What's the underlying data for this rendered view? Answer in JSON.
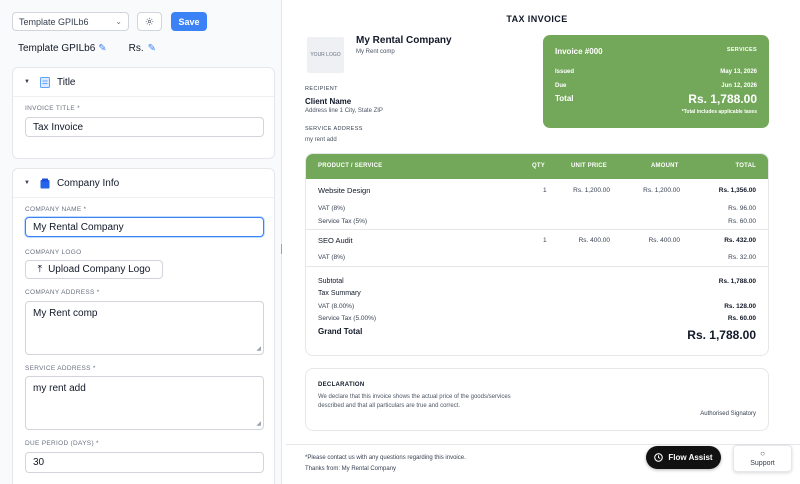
{
  "toolbar": {
    "template_select": "Template GPILb6",
    "save_label": "Save"
  },
  "template_row": {
    "name": "Template GPILb6",
    "currency": "Rs."
  },
  "title_section": {
    "heading": "Title",
    "invoice_title_label": "INVOICE TITLE *",
    "invoice_title_value": "Tax Invoice"
  },
  "company_section": {
    "heading": "Company Info",
    "company_name_label": "COMPANY NAME *",
    "company_name_value": "My Rental Company",
    "company_logo_label": "COMPANY LOGO",
    "upload_label": "Upload Company Logo",
    "company_address_label": "COMPANY ADDRESS *",
    "company_address_value": "My Rent comp",
    "service_address_label": "SERVICE ADDRESS *",
    "service_address_value": "my rent add",
    "due_period_label": "DUE PERIOD (DAYS) *",
    "due_period_value": "30"
  },
  "invoice": {
    "title": "TAX INVOICE",
    "logo_placeholder": "YOUR LOGO",
    "company_name": "My Rental Company",
    "company_sub": "My Rent comp",
    "recipient_label": "RECIPIENT",
    "client_name": "Client Name",
    "client_address": "Address line 1 City, State ZIP",
    "service_address_label": "SERVICE ADDRESS",
    "service_address": "my rent add",
    "summary_card": {
      "invoice_no": "Invoice #000",
      "type": "SERVICES",
      "issued_label": "Issued",
      "issued_value": "May 13, 2026",
      "due_label": "Due",
      "due_value": "Jun 12, 2026",
      "total_label": "Total",
      "total_value": "Rs. 1,788.00",
      "note": "*Total includes applicable taxes"
    },
    "table": {
      "headers": [
        "PRODUCT / SERVICE",
        "QTY",
        "UNIT PRICE",
        "AMOUNT",
        "TOTAL"
      ],
      "items": [
        {
          "name": "Website Design",
          "qty": "1",
          "unit_price": "Rs. 1,200.00",
          "amount": "Rs. 1,200.00",
          "total": "Rs. 1,356.00",
          "taxes": [
            {
              "label": "VAT (8%)",
              "value": "Rs. 96.00"
            },
            {
              "label": "Service Tax (5%)",
              "value": "Rs. 60.00"
            }
          ]
        },
        {
          "name": "SEO Audit",
          "qty": "1",
          "unit_price": "Rs. 400.00",
          "amount": "Rs. 400.00",
          "total": "Rs. 432.00",
          "taxes": [
            {
              "label": "VAT (8%)",
              "value": "Rs. 32.00"
            }
          ]
        }
      ],
      "subtotal_label": "Subtotal",
      "subtotal_value": "Rs. 1,788.00",
      "tax_summary_label": "Tax Summary",
      "tax_summary": [
        {
          "label": "VAT (8.00%)",
          "value": "Rs. 128.00"
        },
        {
          "label": "Service Tax (5.00%)",
          "value": "Rs. 60.00"
        }
      ],
      "grand_total_label": "Grand Total",
      "grand_total_value": "Rs. 1,788.00"
    },
    "declaration": {
      "title": "DECLARATION",
      "text": "We declare that this invoice shows the actual price of the goods/services described and that all particulars are true and correct.",
      "signatory": "Authorised Signatory"
    },
    "footer": {
      "contact_note": "*Please contact us with any questions regarding this invoice.",
      "thanks": "Thanks from: My Rental Company"
    }
  },
  "floating": {
    "flow_assist": "Flow Assist",
    "support": "Support"
  },
  "colors": {
    "accent_blue": "#3b82f6",
    "invoice_green": "#73a85a"
  }
}
